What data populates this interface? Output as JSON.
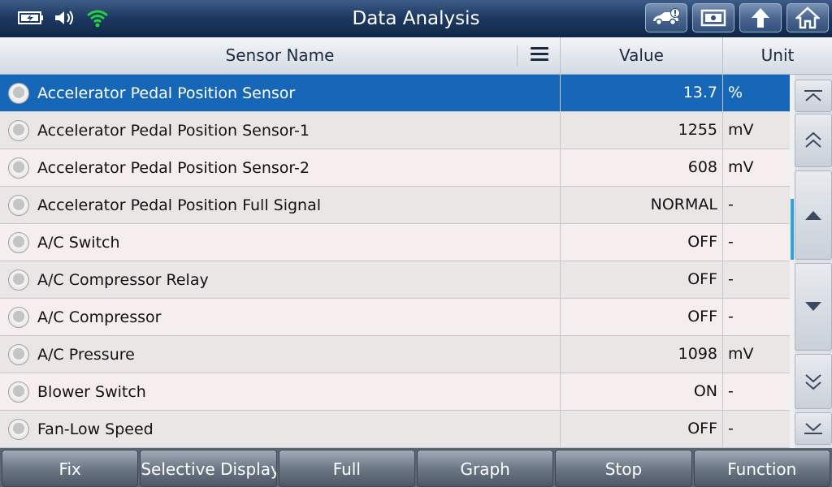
{
  "header": {
    "title": "Data Analysis",
    "status_icons": [
      "battery-icon",
      "speaker-icon",
      "wifi-icon"
    ],
    "buttons": [
      "vehicle-info-icon",
      "print-screen-icon",
      "back-icon",
      "home-icon"
    ]
  },
  "table": {
    "columns": {
      "name": "Sensor Name",
      "value": "Value",
      "unit": "Unit"
    },
    "rows": [
      {
        "name": "Accelerator Pedal Position Sensor",
        "value": "13.7",
        "unit": "%",
        "selected": true
      },
      {
        "name": "Accelerator Pedal Position Sensor-1",
        "value": "1255",
        "unit": "mV"
      },
      {
        "name": "Accelerator Pedal Position Sensor-2",
        "value": "608",
        "unit": "mV"
      },
      {
        "name": "Accelerator Pedal Position Full Signal",
        "value": "NORMAL",
        "unit": "-"
      },
      {
        "name": "A/C Switch",
        "value": "OFF",
        "unit": "-"
      },
      {
        "name": "A/C Compressor Relay",
        "value": "OFF",
        "unit": "-"
      },
      {
        "name": "A/C Compressor",
        "value": "OFF",
        "unit": "-"
      },
      {
        "name": "A/C Pressure",
        "value": "1098",
        "unit": "mV"
      },
      {
        "name": "Blower Switch",
        "value": "ON",
        "unit": "-"
      },
      {
        "name": "Fan-Low Speed",
        "value": "OFF",
        "unit": "-"
      }
    ]
  },
  "toolbar": {
    "fix": "Fix",
    "selective_display": "Selective Display",
    "full": "Full",
    "graph": "Graph",
    "stop": "Stop",
    "function": "Function"
  },
  "colors": {
    "title_bar": "#1f3a63",
    "selected_row": "#1667b8",
    "scroll_indicator": "#2aa4e8"
  }
}
